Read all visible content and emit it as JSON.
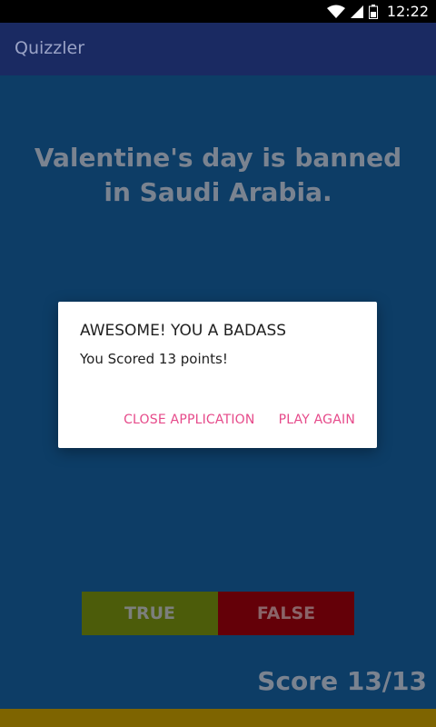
{
  "status_bar": {
    "time": "12:22",
    "icons": [
      "wifi-icon",
      "signal-icon",
      "battery-icon"
    ]
  },
  "app_bar": {
    "title": "Quizzler"
  },
  "quiz": {
    "question": "Valentine's day is banned in Saudi Arabia.",
    "true_label": "TRUE",
    "false_label": "FALSE",
    "score_text": "Score 13/13"
  },
  "dialog": {
    "title": "AWESOME! YOU A BADASS",
    "message": "You Scored 13 points!",
    "close_label": "CLOSE APPLICATION",
    "play_again_label": "PLAY AGAIN"
  },
  "colors": {
    "app_bar": "#1a2a62",
    "background": "#0d3d66",
    "true_button": "#4c5c0a",
    "false_button": "#640008",
    "dialog_accent": "#e64a8a",
    "bottom_bar": "#7e6400"
  }
}
